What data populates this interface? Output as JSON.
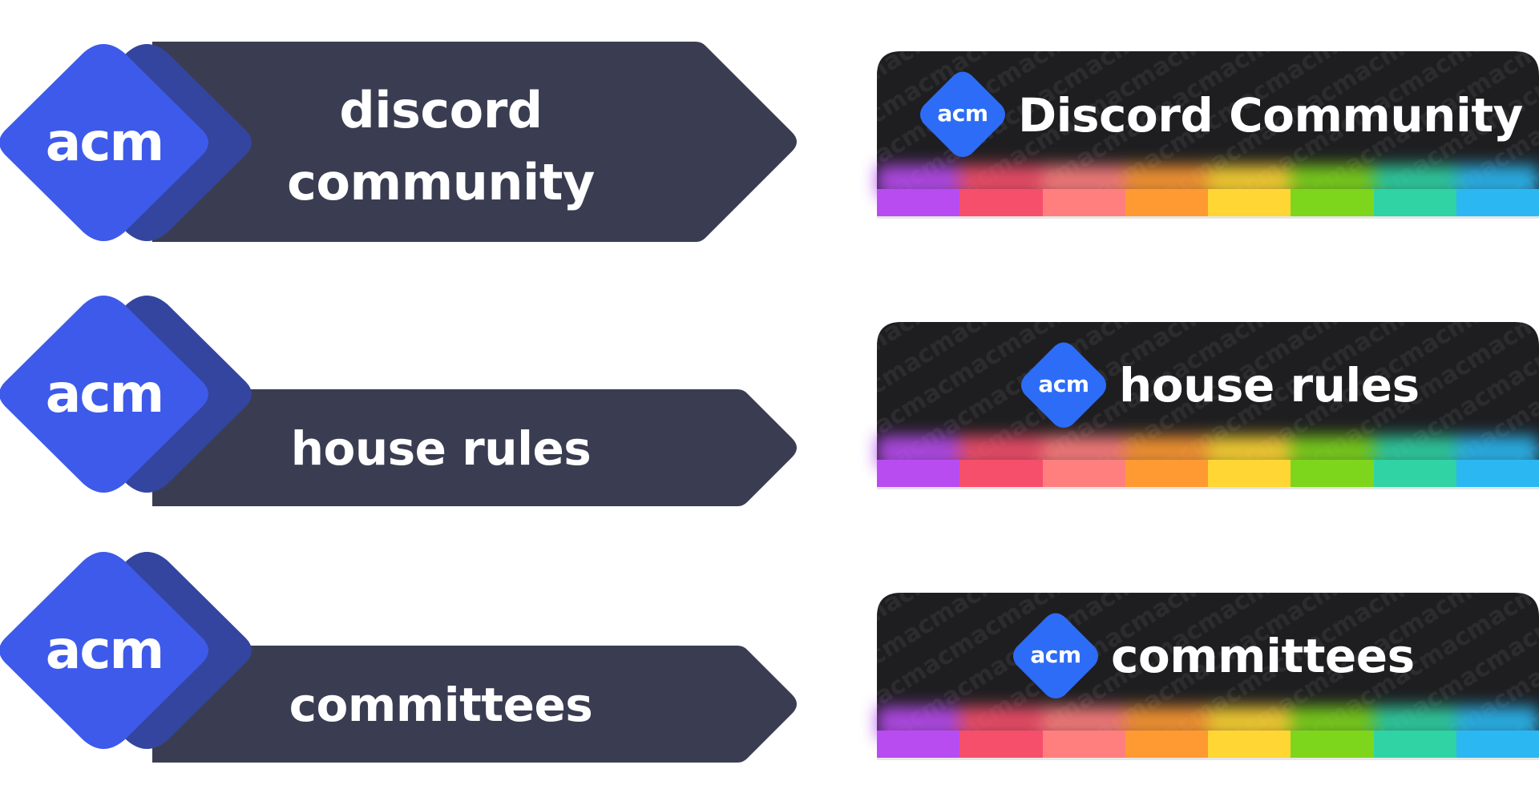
{
  "left_banners": [
    {
      "logo_text": "acm",
      "lines": [
        "discord",
        "community"
      ]
    },
    {
      "logo_text": "acm",
      "lines": [
        "house rules"
      ]
    },
    {
      "logo_text": "acm",
      "lines": [
        "committees"
      ]
    }
  ],
  "right_banners": [
    {
      "logo_text": "acm",
      "title": "Discord Community"
    },
    {
      "logo_text": "acm",
      "title": "house rules"
    },
    {
      "logo_text": "acm",
      "title": "committees"
    }
  ],
  "colors": {
    "logo_blue": "#3d5aea",
    "logo_back": "#34459f",
    "banner_slate": "#3a3d52",
    "right_logo_blue": "#2d6cf6",
    "right_bg": "#1e1e20",
    "stripe_colors": [
      "#b84cf0",
      "#f54f6b",
      "#ff7f7f",
      "#ff9a33",
      "#ffd633",
      "#7ed61c",
      "#2fd3a4",
      "#2bb8f2"
    ]
  }
}
